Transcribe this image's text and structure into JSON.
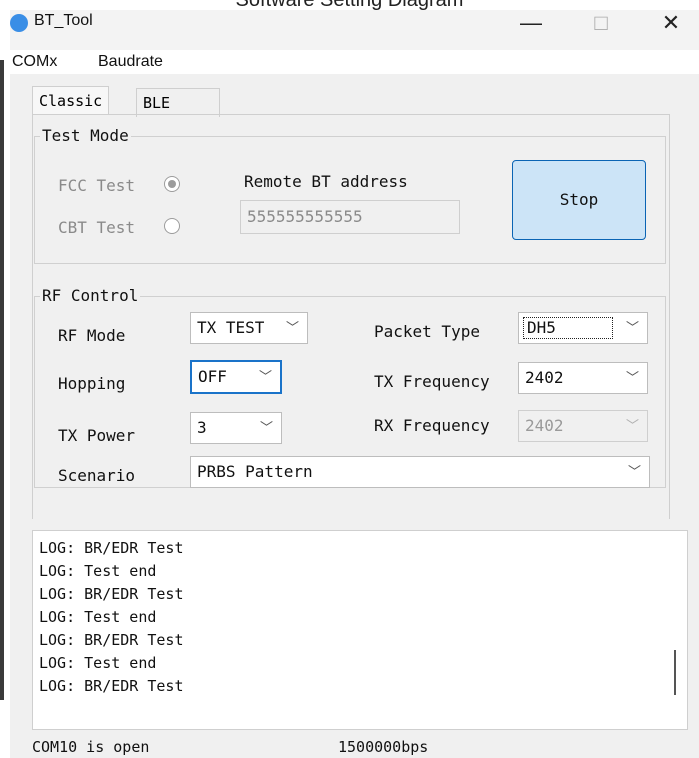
{
  "caption": "Software Setting Diagram",
  "window": {
    "title": "BT_Tool",
    "controls": {
      "minimize": "—",
      "maximize": "□",
      "close": "✕"
    }
  },
  "menu": [
    "COMx",
    "Baudrate"
  ],
  "tabs": [
    "Classic",
    "BLE"
  ],
  "test_mode": {
    "title": "Test Mode",
    "fcc_label": "FCC Test",
    "cbt_label": "CBT Test",
    "selected": "FCC Test",
    "remote_label": "Remote BT address",
    "remote_value": "555555555555",
    "stop_button": "Stop"
  },
  "rf_control": {
    "title": "RF Control",
    "rf_mode": {
      "label": "RF Mode",
      "value": "TX TEST"
    },
    "hopping": {
      "label": "Hopping",
      "value": "OFF"
    },
    "tx_power": {
      "label": "TX Power",
      "value": "3"
    },
    "scenario": {
      "label": "Scenario",
      "value": "PRBS Pattern"
    },
    "packet_type": {
      "label": "Packet Type",
      "value": "DH5"
    },
    "tx_frequency": {
      "label": "TX Frequency",
      "value": "2402"
    },
    "rx_frequency": {
      "label": "RX Frequency",
      "value": "2402"
    }
  },
  "log": [
    "LOG: BR/EDR Test",
    "LOG: Test end",
    "LOG: BR/EDR Test",
    "LOG: Test end",
    "LOG: BR/EDR Test",
    "LOG: Test end",
    "LOG: BR/EDR Test"
  ],
  "status": {
    "port": "COM10 is open",
    "baud": "1500000bps"
  },
  "colors": {
    "accent": "#0a64b4",
    "button_fill": "#cce4f7",
    "app_icon": "#3a8ee6"
  },
  "icons": {
    "app": "bt-tool-icon",
    "dropdown": "chevron-down-icon"
  }
}
